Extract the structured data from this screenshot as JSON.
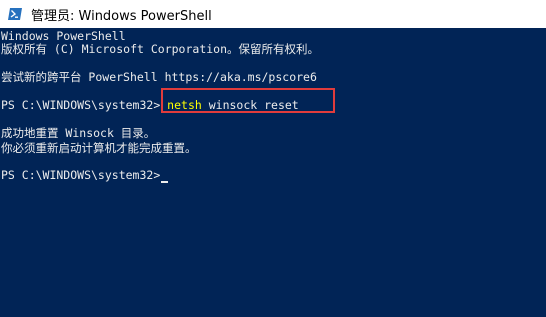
{
  "window": {
    "title": "管理员: Windows PowerShell",
    "icon": "powershell-icon"
  },
  "console": {
    "header_line_1": "Windows PowerShell",
    "header_line_2": "版权所有 (C) Microsoft Corporation。保留所有权利。",
    "header_line_3": "尝试新的跨平台 PowerShell https://aka.ms/pscore6",
    "prompt_1": "PS C:\\WINDOWS\\system32> ",
    "command_name": "netsh",
    "command_args": " winsock reset",
    "output_line_1": "成功地重置 Winsock 目录。",
    "output_line_2": "你必须重新启动计算机才能完成重置。",
    "prompt_2": "PS C:\\WINDOWS\\system32>"
  },
  "colors": {
    "console_background": "#012456",
    "console_text": "#ececec",
    "command_highlight": "#ffff00",
    "annotation_border": "#e03c3c"
  }
}
